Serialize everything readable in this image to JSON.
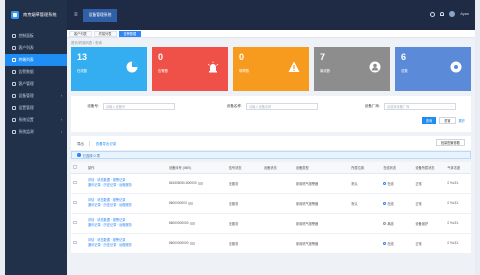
{
  "app": {
    "title": "南京烟草管理系统"
  },
  "sidebar": {
    "items": [
      {
        "label": "控制面板",
        "active": false,
        "arrow": false
      },
      {
        "label": "客户列表",
        "active": false,
        "arrow": false
      },
      {
        "label": "终端列表",
        "active": true,
        "arrow": false
      },
      {
        "label": "告警数据",
        "active": false,
        "arrow": false
      },
      {
        "label": "客户管理",
        "active": false,
        "arrow": false
      },
      {
        "label": "设备管理",
        "active": false,
        "arrow": true
      },
      {
        "label": "设置管理",
        "active": false,
        "arrow": false
      },
      {
        "label": "系统设置",
        "active": false,
        "arrow": true
      },
      {
        "label": "系统监测",
        "active": false,
        "arrow": true
      }
    ]
  },
  "topbar": {
    "tab": "设备管理系统",
    "user": "Ayan"
  },
  "crumbs": [
    "客户列表",
    "终端列表",
    "告警数据"
  ],
  "path": "首页/终端列表 / 查询",
  "cards": [
    {
      "num": "13",
      "label": "在线数",
      "icon": "pie-icon"
    },
    {
      "num": "0",
      "label": "告警数",
      "icon": "alarm-icon"
    },
    {
      "num": "0",
      "label": "故障数",
      "icon": "warning-icon"
    },
    {
      "num": "7",
      "label": "离线数",
      "icon": "user-icon"
    },
    {
      "num": "6",
      "label": "总数",
      "icon": "location-icon"
    }
  ],
  "filter": {
    "f1_label": "设备号:",
    "f1_placeholder": "请输入设备号",
    "f2_label": "设备名称:",
    "f2_placeholder": "请输入设备名称",
    "f3_label": "设备厂商:",
    "f3_placeholder": "请选择设备厂商",
    "query": "查询",
    "reset": "重置",
    "more": "展开"
  },
  "toolbar": {
    "export": "导出",
    "link": "查看导出记录",
    "right_btn": "批量配置参数"
  },
  "selection": "已选择 0 项",
  "table": {
    "headers": [
      "",
      "操作",
      "设备序号 (IMEI)",
      "信号状态",
      "设备状态",
      "设备类型",
      "所属位置",
      "在线状态",
      "设备所属状态",
      "气体浓度"
    ],
    "op_lines": [
      "详情 · 状态数据 · 报警记录",
      "通讯记录 · 历史记录 · 远程服务"
    ],
    "rows": [
      {
        "imei": "861508030-800000",
        "sig": "无服务",
        "status": "",
        "type": "家用燃气报警器",
        "loc": "默认",
        "online": "在线",
        "owner": "正常",
        "gas": "0 %LEL"
      },
      {
        "imei": "8600000003",
        "sig": "无服务",
        "status": "",
        "type": "家用燃气报警器",
        "loc": "默认",
        "online": "在线",
        "owner": "正常",
        "gas": "0 %LEL"
      },
      {
        "imei": "86000000000",
        "sig": "无服务",
        "status": "",
        "type": "家用燃气报警器",
        "loc": "",
        "online": "离线",
        "owner": "设备维护",
        "gas": "0 %LEL"
      },
      {
        "imei": "86000000000",
        "sig": "无服务",
        "status": "",
        "type": "家用燃气报警器",
        "loc": "",
        "online": "在线",
        "owner": "正常",
        "gas": "0 %LEL"
      }
    ]
  },
  "colors": {
    "accent": "#1f8cf0",
    "sidebar": "#22314a",
    "topbar": "#1f2a44"
  }
}
